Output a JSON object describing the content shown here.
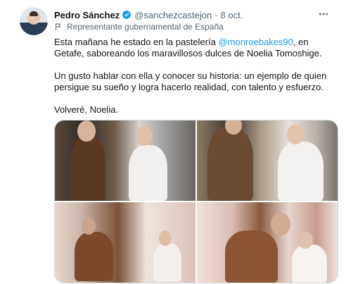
{
  "author": {
    "name": "Pedro Sánchez",
    "handle": "@sanchezcastejon",
    "separator": "·",
    "date": "8 oct."
  },
  "account_label": "Representante gubernamental de España",
  "tweet": {
    "p1_before": "Esta mañana he estado en la pastelería ",
    "mention": "@monroebakes90",
    "p1_after": ", en Getafe, saboreando los maravillosos dulces de Noelia Tomoshige.",
    "p2": "Un gusto hablar con ella y conocer su historia: un ejemplo de quien persigue su sueño y logra hacerlo realidad, con talento y esfuerzo.",
    "p3": "Volveré, Noelia."
  },
  "icons": {
    "verified": "verified-badge-icon",
    "more": "more-options-icon",
    "label": "government-flag-icon"
  },
  "colors": {
    "accent": "#1d9bf0",
    "secondary_text": "#536471",
    "primary_text": "#0f1419"
  }
}
